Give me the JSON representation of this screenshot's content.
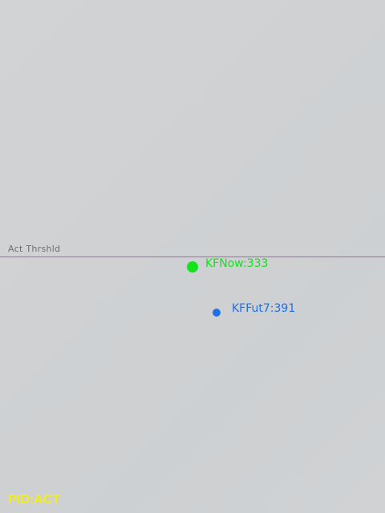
{
  "threshold": {
    "label": "Act Thrshld",
    "line_color": "#8a7f8c",
    "label_color": "#6f6f6f"
  },
  "markers": {
    "now": {
      "label": "KFNow:333",
      "color": "#12e31a"
    },
    "future": {
      "label": "KFFut7:391",
      "color": "#1f6fe6"
    }
  },
  "status": {
    "text": "PID:ACT",
    "color": "#f2ee1a"
  }
}
